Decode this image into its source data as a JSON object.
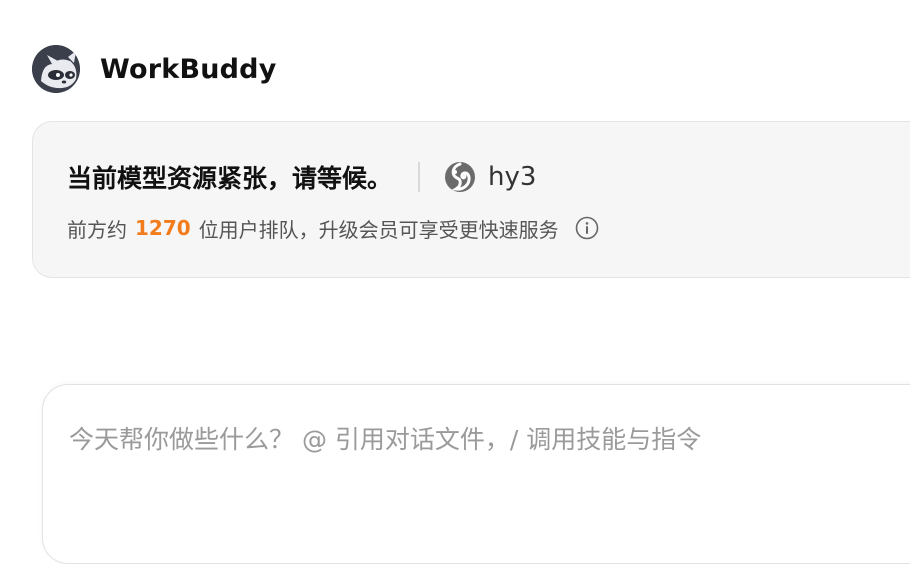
{
  "app": {
    "title": "WorkBuddy",
    "avatar_icon": "raccoon-avatar-icon"
  },
  "notice": {
    "title": "当前模型资源紧张，请等候。",
    "model": {
      "icon": "hy-model-icon",
      "name": "hy3"
    },
    "queue": {
      "prefix": "前方约",
      "count": "1270",
      "suffix": "位用户排队，升级会员可享受更快速服务"
    },
    "info_icon": "info-icon"
  },
  "input": {
    "placeholder": "今天帮你做些什么？ @ 引用对话文件，/ 调用技能与指令",
    "value": ""
  },
  "colors": {
    "accent": "#f27c1c",
    "card_bg": "#f6f6f6",
    "avatar_bg": "#3b3f4c"
  }
}
